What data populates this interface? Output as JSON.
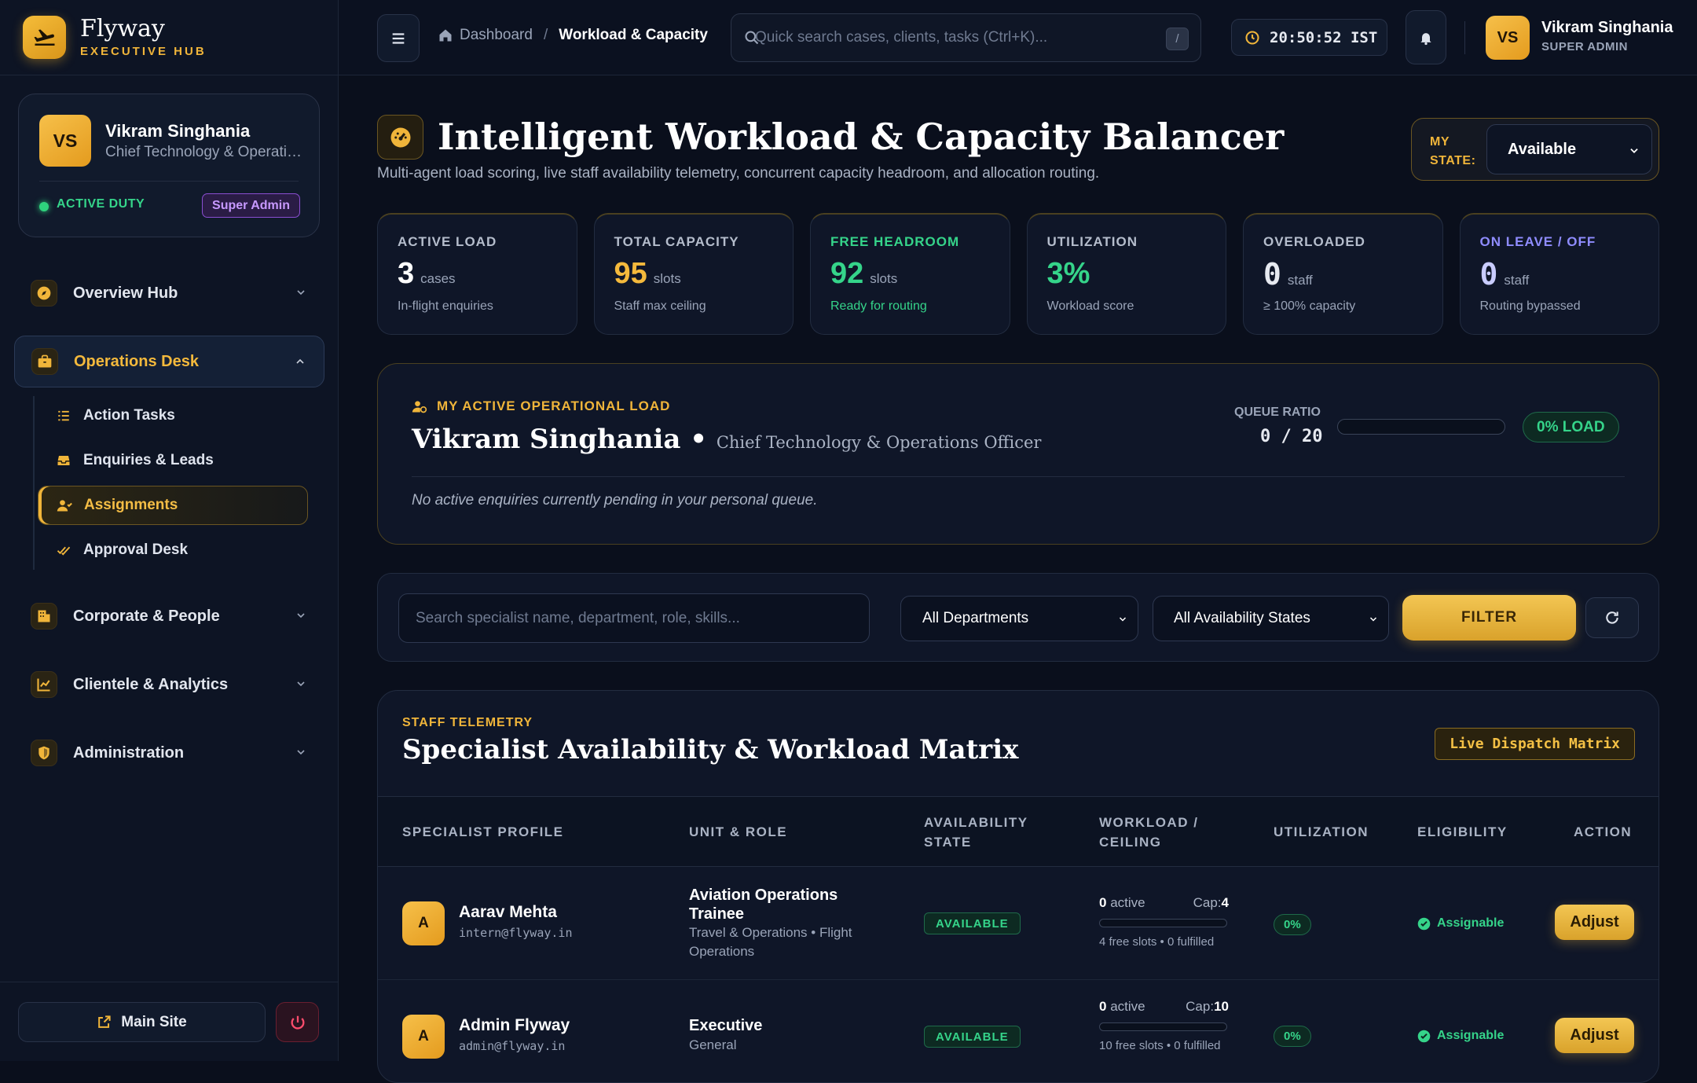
{
  "brand": {
    "name": "Flyway",
    "sub": "EXECUTIVE HUB"
  },
  "profile": {
    "initials": "VS",
    "name": "Vikram Singhania",
    "role": "Chief Technology & Operations Officer",
    "status": "ACTIVE DUTY",
    "badge": "Super Admin"
  },
  "nav": [
    {
      "label": "Overview Hub",
      "icon": "compass-icon"
    },
    {
      "label": "Operations Desk",
      "icon": "briefcase-icon",
      "expanded": true,
      "items": [
        {
          "label": "Action Tasks"
        },
        {
          "label": "Enquiries & Leads"
        },
        {
          "label": "Assignments",
          "active": true
        },
        {
          "label": "Approval Desk"
        }
      ]
    },
    {
      "label": "Corporate & People",
      "icon": "building-icon"
    },
    {
      "label": "Clientele & Analytics",
      "icon": "chart-icon"
    },
    {
      "label": "Administration",
      "icon": "shield-icon"
    }
  ],
  "footer": {
    "main_site": "Main Site"
  },
  "topbar": {
    "breadcrumb_home": "Dashboard",
    "breadcrumb_sep": "/",
    "breadcrumb_current": "Workload & Capacity",
    "search_placeholder": "Quick search cases, clients, tasks (Ctrl+K)...",
    "search_shortcut": "/",
    "clock": "20:50:52 IST",
    "user": {
      "initials": "VS",
      "name": "Vikram Singhania",
      "role": "SUPER ADMIN"
    }
  },
  "page": {
    "title": "Intelligent Workload & Capacity Balancer",
    "subtitle": "Multi-agent load scoring, live staff availability telemetry, concurrent capacity headroom, and allocation routing.",
    "state_label_1": "MY",
    "state_label_2": "STATE:",
    "state_value": "Available"
  },
  "kpis": [
    {
      "label": "ACTIVE LOAD",
      "value": "3",
      "unit": "cases",
      "desc": "In-flight enquiries",
      "label_color": "#b5bdcc",
      "value_color": "#ffffff",
      "desc_color": "#9aa4b8"
    },
    {
      "label": "TOTAL CAPACITY",
      "value": "95",
      "unit": "slots",
      "desc": "Staff max ceiling",
      "label_color": "#b5bdcc",
      "value_color": "#f4b93c",
      "desc_color": "#9aa4b8"
    },
    {
      "label": "FREE HEADROOM",
      "value": "92",
      "unit": "slots",
      "desc": "Ready for routing",
      "label_color": "#35d48a",
      "value_color": "#35d48a",
      "desc_color": "#35d48a"
    },
    {
      "label": "UTILIZATION",
      "value": "3%",
      "unit": "",
      "desc": "Workload score",
      "label_color": "#b5bdcc",
      "value_color": "#35d48a",
      "desc_color": "#9aa4b8"
    },
    {
      "label": "OVERLOADED",
      "value": "0",
      "unit": "staff",
      "desc": "≥ 100% capacity",
      "label_color": "#b5bdcc",
      "value_color": "#e6e9f0",
      "desc_color": "#9aa4b8"
    },
    {
      "label": "ON LEAVE / OFF",
      "value": "0",
      "unit": "staff",
      "desc": "Routing bypassed",
      "label_color": "#8f8cff",
      "value_color": "#c9ccff",
      "desc_color": "#9aa4b8"
    }
  ],
  "my_load": {
    "kicker": "MY ACTIVE OPERATIONAL LOAD",
    "name": "Vikram Singhania",
    "bullet": "•",
    "role": "Chief Technology & Operations Officer",
    "queue_label": "QUEUE RATIO",
    "queue_value": "0 / 20",
    "queue_fraction": 0,
    "load_pill": "0% LOAD",
    "empty": "No active enquiries currently pending in your personal queue."
  },
  "filters": {
    "search_placeholder": "Search specialist name, department, role, skills...",
    "department": "All Departments",
    "availability": "All Availability States",
    "button": "FILTER"
  },
  "matrix": {
    "kicker": "STAFF TELEMETRY",
    "title": "Specialist Availability & Workload Matrix",
    "badge": "Live Dispatch Matrix",
    "columns": [
      "SPECIALIST PROFILE",
      "UNIT & ROLE",
      "AVAILABILITY",
      "STATE",
      "WORKLOAD /",
      "CEILING",
      "UTILIZATION",
      "ELIGIBILITY",
      "ACTION"
    ],
    "rows": [
      {
        "initial": "A",
        "name": "Aarav Mehta",
        "email": "intern@flyway.in",
        "unit": "Aviation Operations Trainee",
        "sub": "Travel & Operations • Flight Operations",
        "availability": "AVAILABLE",
        "active": "0",
        "active_label": "active",
        "cap_label": "Cap:",
        "cap": "4",
        "fraction": 0,
        "note": "4 free slots • 0 fulfilled",
        "util": "0%",
        "eligibility": "Assignable",
        "action": "Adjust"
      },
      {
        "initial": "A",
        "name": "Admin Flyway",
        "email": "admin@flyway.in",
        "unit": "Executive",
        "sub": "General",
        "availability": "AVAILABLE",
        "active": "0",
        "active_label": "active",
        "cap_label": "Cap:",
        "cap": "10",
        "fraction": 0,
        "note": "10 free slots • 0 fulfilled",
        "util": "0%",
        "eligibility": "Assignable",
        "action": "Adjust"
      }
    ]
  }
}
